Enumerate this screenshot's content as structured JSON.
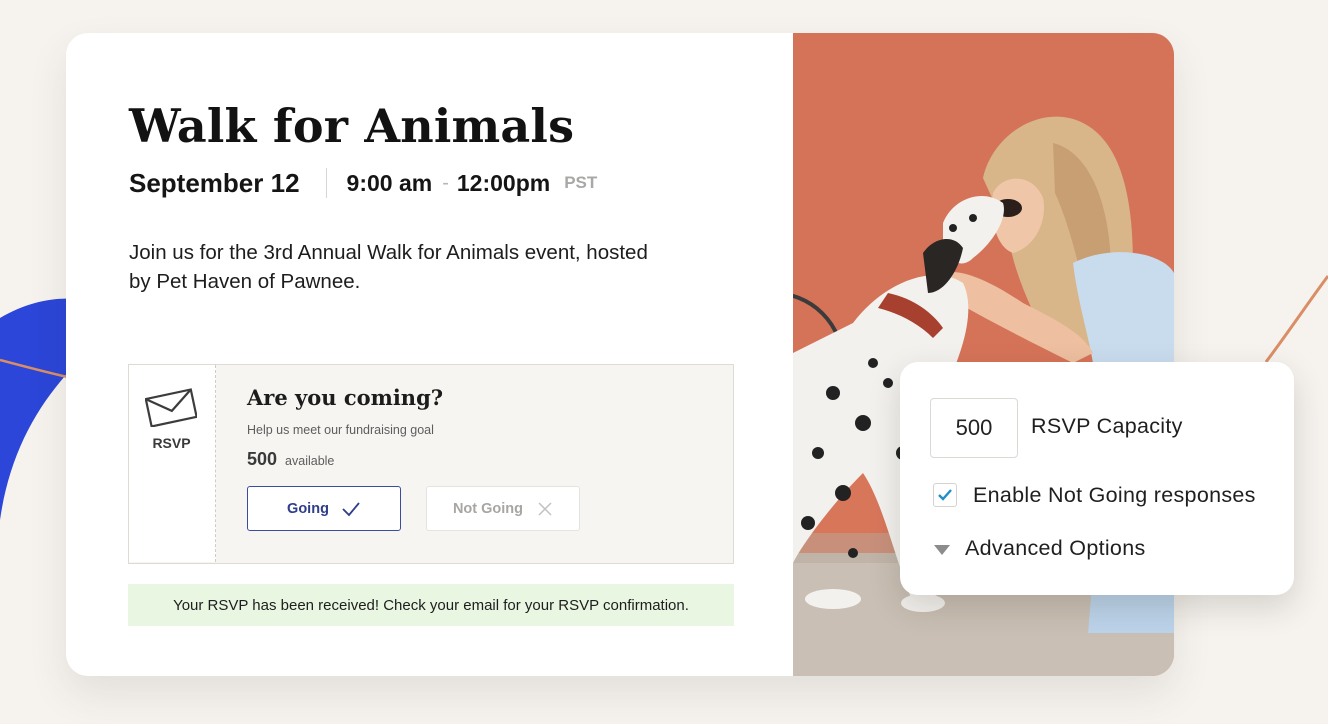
{
  "colors": {
    "page_background": "#f6f3ef",
    "accent_blue": "#3a4c9e",
    "decor_blue": "#2b46d8",
    "decor_line": "#d98e66",
    "photo_wall": "#d8765a",
    "success_background": "#e9f6e2",
    "checkbox_check": "#1f8fc9"
  },
  "event": {
    "title": "Walk for Animals",
    "date": "September 12",
    "start_time": "9:00 am",
    "separator": "-",
    "end_time": "12:00pm",
    "timezone": "PST",
    "description": "Join us for the 3rd Annual Walk for Animals event, hosted by Pet Haven of Pawnee."
  },
  "rsvp": {
    "icon": "envelope-icon",
    "tag": "RSVP",
    "question": "Are you coming?",
    "help_text": "Help us meet our fundraising goal",
    "available_count": "500",
    "available_label": "available",
    "going_label": "Going",
    "going_icon": "checkmark-icon",
    "not_going_label": "Not Going",
    "not_going_icon": "close-icon"
  },
  "confirmation": {
    "message": "Your RSVP has been received! Check your email for your RSVP confirmation."
  },
  "settings_panel": {
    "capacity_value": "500",
    "capacity_label": "RSVP Capacity",
    "enable_not_going_checked": true,
    "enable_not_going_label": "Enable Not Going responses",
    "advanced_label": "Advanced Options",
    "advanced_icon": "caret-down-icon"
  },
  "photo": {
    "subject": "woman kissing a dalmatian dog in front of an orange wall"
  }
}
